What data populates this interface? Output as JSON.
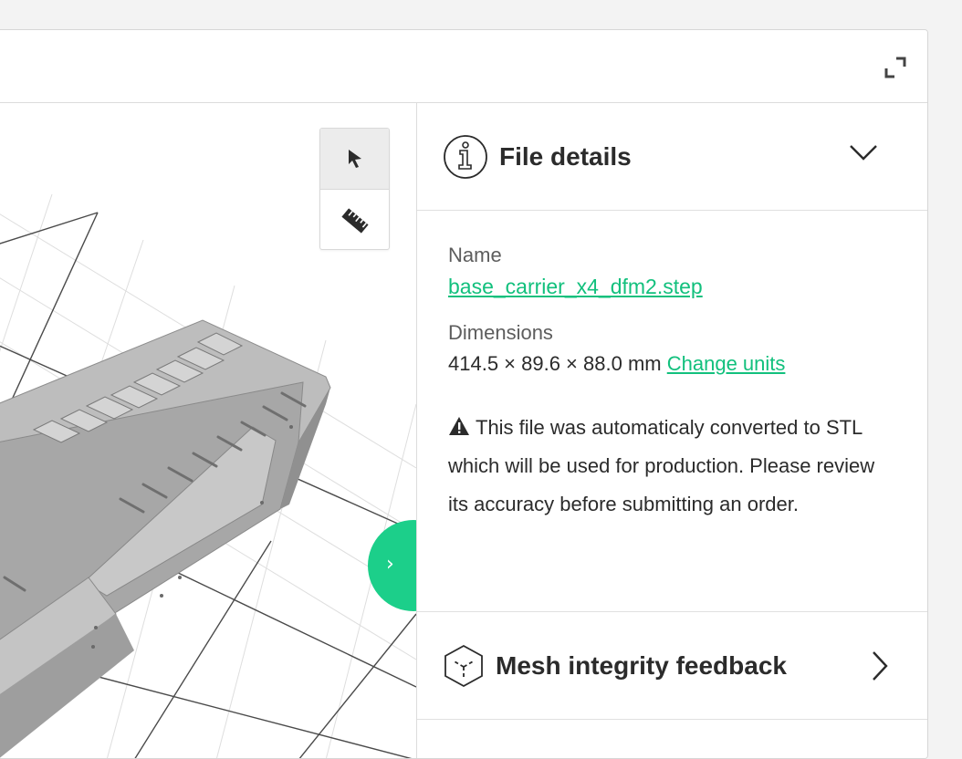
{
  "viewer": {
    "tools": [
      {
        "name": "select",
        "icon": "cursor-arrow-icon",
        "active": true
      },
      {
        "name": "measure",
        "icon": "ruler-icon",
        "active": false
      }
    ],
    "collapse_glyph": "›"
  },
  "panel": {
    "file_details": {
      "title": "File details",
      "icon": "info-icon",
      "name_label": "Name",
      "file_name": "base_carrier_x4_dfm2.step",
      "dimensions_label": "Dimensions",
      "dimensions_value": "414.5 × 89.6 × 88.0 mm",
      "change_units": "Change units",
      "warning": "This file was automaticaly converted to STL which will be used for production. Please review its accuracy before submitting an order."
    },
    "mesh": {
      "title": "Mesh integrity feedback",
      "icon": "cube-icon"
    }
  },
  "colors": {
    "accent": "#1ccf8a",
    "link": "#12c07d",
    "part_gray": "#a9a9a9"
  }
}
